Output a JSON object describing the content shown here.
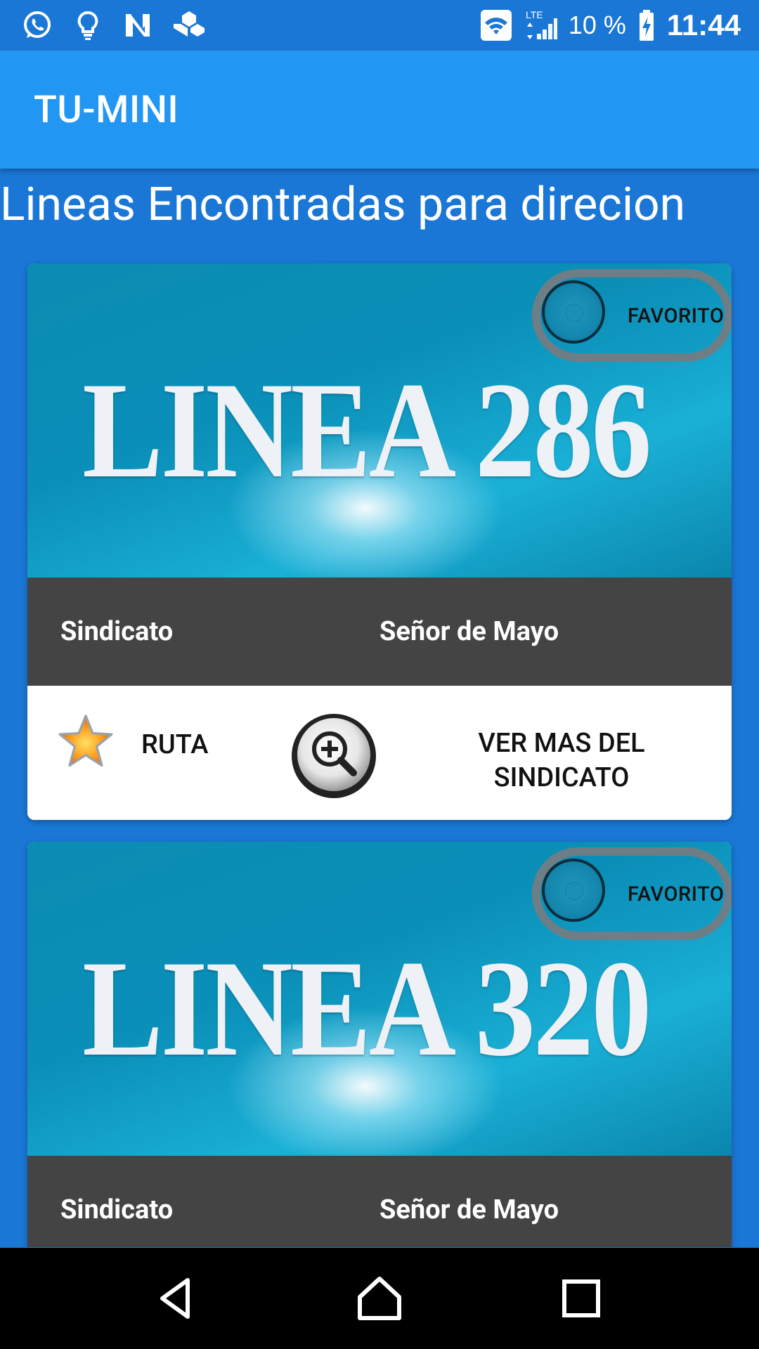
{
  "status_bar": {
    "left_icons": [
      "whatsapp-icon",
      "lightbulb-icon",
      "n-app-icon",
      "cubes-app-icon"
    ],
    "right_icons": [
      "wifi-icon",
      "lte-signal-icon",
      "battery-charging-icon"
    ],
    "network": "LTE",
    "battery": "10 %",
    "time": "11:44"
  },
  "app_bar": {
    "title": "TU-MINI"
  },
  "main": {
    "heading": "Lineas Encontradas para direcion",
    "cards": [
      {
        "line_title": "LINEA 286",
        "favorite_label": "FAVORITO",
        "favorite_on": false,
        "info_left": "Sindicato",
        "info_right": "Señor de Mayo",
        "route_label": "RUTA",
        "more_label_line1": "VER MAS DEL",
        "more_label_line2": "SINDICATO"
      },
      {
        "line_title": "LINEA 320",
        "favorite_label": "FAVORITO",
        "favorite_on": false,
        "info_left": "Sindicato",
        "info_right": "Señor de Mayo"
      }
    ]
  },
  "nav_bar": {
    "icons": [
      "back-icon",
      "home-icon",
      "recents-icon"
    ]
  },
  "colors": {
    "status_bar": "#1a77d6",
    "app_bar": "#2196f3",
    "background": "#1a77d6",
    "info_band": "#444444",
    "card_image": "#0a8fb8"
  }
}
